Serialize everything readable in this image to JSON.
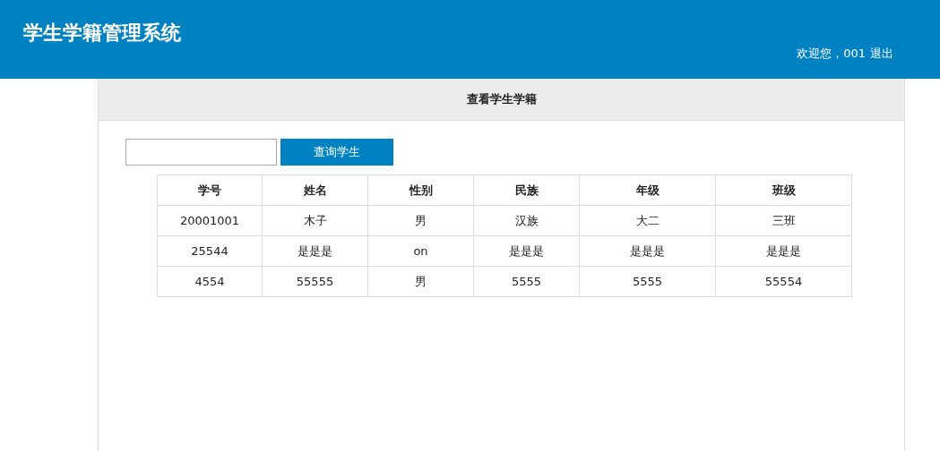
{
  "header": {
    "title": "学生学籍管理系统",
    "welcome": "欢迎您，001",
    "logout": "退出"
  },
  "panel": {
    "title": "查看学生学籍"
  },
  "search": {
    "button": "查询学生"
  },
  "table": {
    "columns": [
      "学号",
      "姓名",
      "性别",
      "民族",
      "年级",
      "班级"
    ],
    "rows": [
      [
        "20001001",
        "木子",
        "男",
        "汉族",
        "大二",
        "三班"
      ],
      [
        "25544",
        "是是是",
        "on",
        "是是是",
        "是是是",
        "是是是"
      ],
      [
        "4554",
        "55555",
        "男",
        "5555",
        "5555",
        "55554"
      ]
    ]
  }
}
